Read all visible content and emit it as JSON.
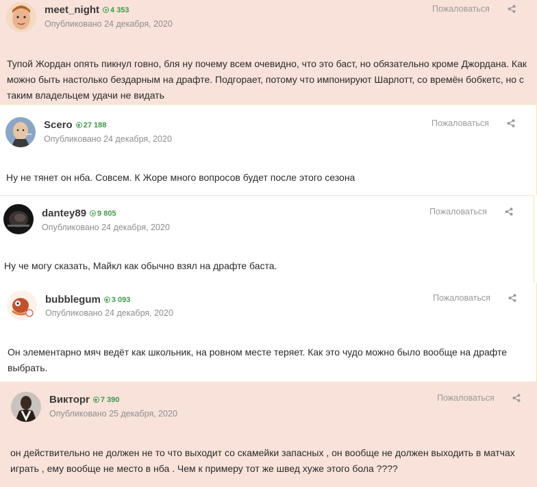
{
  "report_label": "Пожаловаться",
  "share_icon": "share-icon",
  "rep_icon": "plus-circle-icon",
  "colors": {
    "highlight_bg": "#f8e2da",
    "rep_green": "#3c9a4a",
    "border_yellow": "#f3e6b4"
  },
  "posts": [
    {
      "author": "meet_night",
      "reputation": "4 353",
      "date": "Опубликовано 24 декабря, 2020",
      "text": "Тупой Жордан опять пикнул говно, бля ну почему всем очевидно, что это баст, но обязательно кроме Джордана. Как можно быть настолько бездарным на драфте. Подгорает, потому что импонируют Шарлотт, со времён бобкетс, но с таким владельцем удачи не видать"
    },
    {
      "author": "Scero",
      "reputation": "27 188",
      "date": "Опубликовано 24 декабря, 2020",
      "text": "Ну не тянет он нба. Совсем. К Жоре много вопросов будет после этого сезона"
    },
    {
      "author": "dantey89",
      "reputation": "9 805",
      "date": "Опубликовано 24 декабря, 2020",
      "text": "Ну че могу сказать, Майкл как обычно взял на драфте баста."
    },
    {
      "author": "bubblegum",
      "reputation": "3 093",
      "date": "Опубликовано 24 декабря, 2020",
      "text": "Он элементарно мяч ведёт как школьник, на ровном месте теряет. Как это чудо можно было вообще на драфте выбрать."
    },
    {
      "author": "Викторr",
      "reputation": "7 390",
      "date": "Опубликовано 25 декабря, 2020",
      "text": "он действительно не должен не то что выходит со скамейки запасных , он вообще не должен выходить в матчах играть , ему вообще не место в нба . Чем к примеру тот же швед хуже этого бола ????"
    }
  ]
}
